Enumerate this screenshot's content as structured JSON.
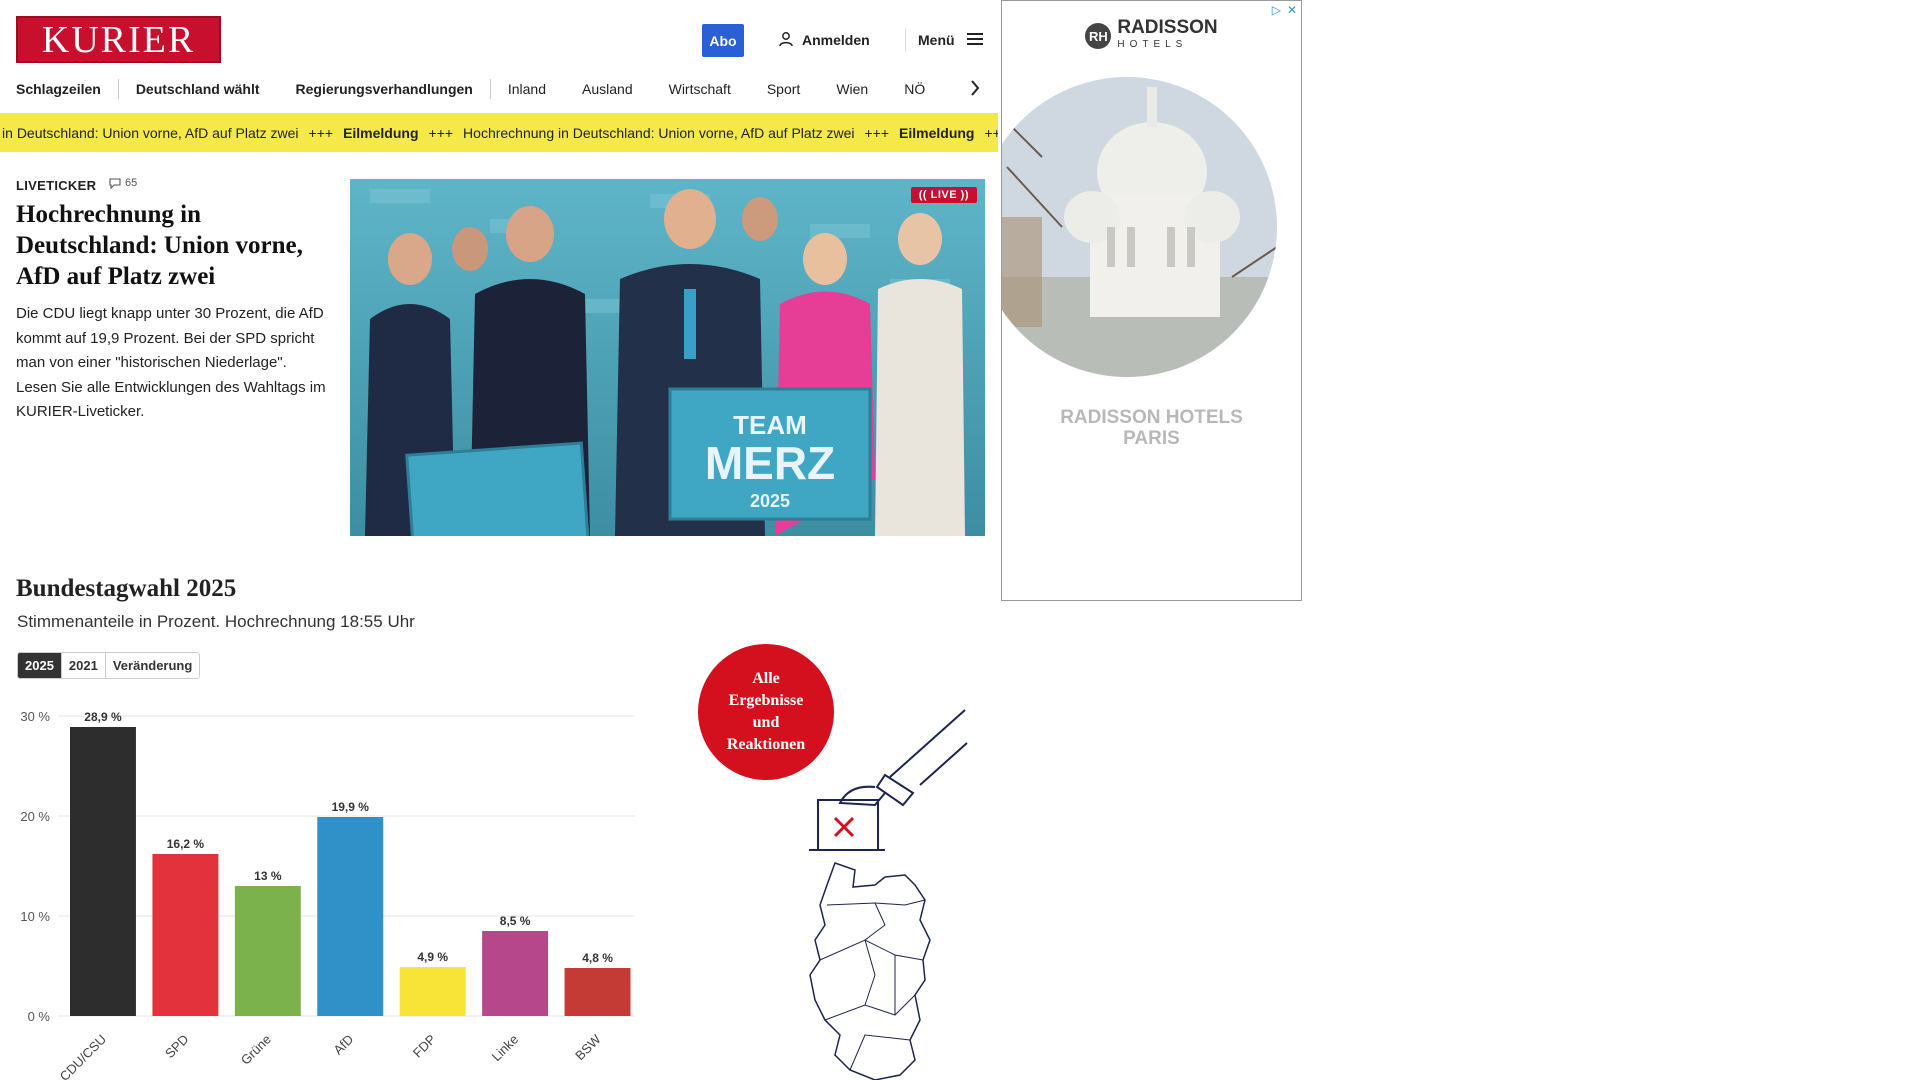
{
  "header": {
    "logo": "KURIER",
    "abo_label": "Abo",
    "login_label": "Anmelden",
    "menu_label": "Menü"
  },
  "nav": {
    "items": [
      "Schlagzeilen",
      "Deutschland wählt",
      "Regierungsverhandlungen",
      "Inland",
      "Ausland",
      "Wirtschaft",
      "Sport",
      "Wien",
      "NÖ"
    ]
  },
  "ticker": {
    "items": [
      {
        "text": "nung in Deutschland: Union vorne, AfD auf Platz zwei",
        "bold": false
      },
      {
        "text": "+++",
        "bold": false
      },
      {
        "text": "Eilmeldung",
        "bold": true
      },
      {
        "text": "+++",
        "bold": false
      },
      {
        "text": "Hochrechnung in Deutschland: Union vorne, AfD auf Platz zwei",
        "bold": false
      },
      {
        "text": "+++",
        "bold": false
      },
      {
        "text": "Eilmeldung",
        "bold": true
      },
      {
        "text": "+++",
        "bold": false
      }
    ],
    "color": "#f5e94a"
  },
  "article": {
    "tag": "LIVETICKER",
    "comment_count": "65",
    "headline": "Hochrechnung in Deutschland: Union vorne, AfD auf Platz zwei",
    "lead": "Die CDU liegt knapp unter 30 Prozent, die AfD kommt auf 19,9 Prozent. Bei der SPD spricht man von einer \"historischen Niederlage\". Lesen Sie alle Entwicklungen des Wahltags im KURIER-Liveticker.",
    "live_badge": "LIVE",
    "photo_signs": [
      "TEAM",
      "MERZ",
      "2025"
    ]
  },
  "election": {
    "title": "Bundestagwahl 2025",
    "subtitle": "Stimmenanteile in Prozent. Hochrechnung 18:55 Uhr",
    "tabs": [
      {
        "label": "2025",
        "active": true
      },
      {
        "label": "2021",
        "active": false
      },
      {
        "label": "Veränderung",
        "active": false
      }
    ],
    "results_button": "Alle Ergebnisse und Reaktionen"
  },
  "chart_data": {
    "type": "bar",
    "categories": [
      "CDU/CSU",
      "SPD",
      "Grüne",
      "AfD",
      "FDP",
      "Linke",
      "BSW"
    ],
    "values": [
      28.9,
      16.2,
      13,
      19.9,
      4.9,
      8.5,
      4.8
    ],
    "value_labels": [
      "28,9 %",
      "16,2 %",
      "13 %",
      "19,9 %",
      "4,9 %",
      "8,5 %",
      "4,8 %"
    ],
    "colors": [
      "#2d2d2d",
      "#e3323b",
      "#7cb24c",
      "#3091c8",
      "#f7e437",
      "#b6478a",
      "#c43a35"
    ],
    "y_ticks": [
      0,
      10,
      20,
      30
    ],
    "y_tick_labels": [
      "0 %",
      "10 %",
      "20 %",
      "30 %"
    ],
    "ylim": [
      0,
      30
    ],
    "grid": true,
    "title": "",
    "xlabel": "",
    "ylabel": ""
  },
  "ad": {
    "brand": "RADISSON",
    "brand_sub": "HOTELS",
    "caption_line1": "RADISSON HOTELS",
    "caption_line2": "PARIS"
  }
}
